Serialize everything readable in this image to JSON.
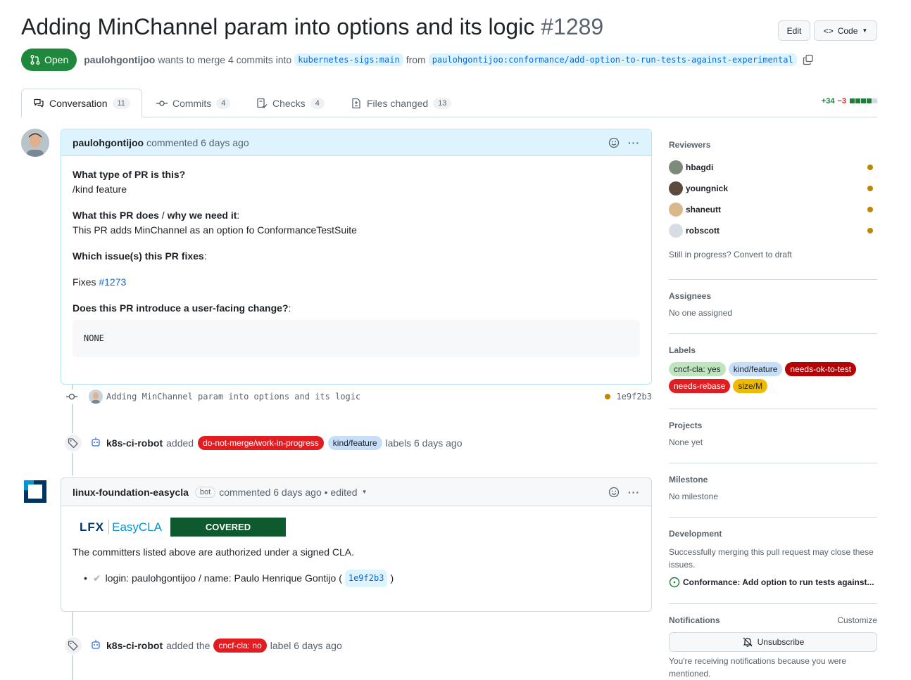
{
  "pr": {
    "title": "Adding MinChannel param into options and its logic",
    "number": "#1289",
    "state": "Open",
    "author": "paulohgontijoo",
    "merge_text": "wants to merge 4 commits into",
    "base_branch": "kubernetes-sigs:main",
    "from_text": "from",
    "head_branch": "paulohgontijoo:conformance/add-option-to-run-tests-against-experimental"
  },
  "header_buttons": {
    "edit": "Edit",
    "code": "Code"
  },
  "tabs": [
    {
      "label": "Conversation",
      "count": "11"
    },
    {
      "label": "Commits",
      "count": "4"
    },
    {
      "label": "Checks",
      "count": "4"
    },
    {
      "label": "Files changed",
      "count": "13"
    }
  ],
  "diffstat": {
    "additions": "+34",
    "deletions": "−3"
  },
  "comment1": {
    "author": "paulohgontijoo",
    "meta": "commented 6 days ago",
    "q1": "What type of PR is this?",
    "a1": "/kind feature",
    "q2_a": "What this PR does",
    "q2_sep": " / ",
    "q2_b": "why we need it",
    "q2_colon": ":",
    "a2": "This PR adds MinChannel as an option fo ConformanceTestSuite",
    "q3": "Which issue(s) this PR fixes",
    "q3_colon": ":",
    "fixes_text": "Fixes",
    "fixes_link": "#1273",
    "q4": "Does this PR introduce a user-facing change?",
    "q4_colon": ":",
    "code": "NONE"
  },
  "commit_event": {
    "message": "Adding MinChannel param into options and its logic",
    "sha": "1e9f2b3"
  },
  "label_event1": {
    "actor": "k8s-ci-robot",
    "verb": "added",
    "labels": [
      {
        "name": "do-not-merge/work-in-progress",
        "bg": "#e11d21",
        "fg": "#ffffff"
      },
      {
        "name": "kind/feature",
        "bg": "#c7def8",
        "fg": "#1f2328"
      }
    ],
    "suffix": "labels 6 days ago"
  },
  "comment2": {
    "author": "linux-foundation-easycla",
    "badge": "bot",
    "meta": "commented 6 days ago • edited",
    "logo_lfx": "LFX",
    "logo_easycla": "EasyCLA",
    "covered": "COVERED",
    "text": "The committers listed above are authorized under a signed CLA.",
    "item": "login: paulohgontijoo / name: Paulo Henrique Gontijo (",
    "item_sha": "1e9f2b3",
    "item_close": ")"
  },
  "label_event2": {
    "actor": "k8s-ci-robot",
    "verb": "added the",
    "label": {
      "name": "cncf-cla: no",
      "bg": "#e11d21",
      "fg": "#ffffff"
    },
    "suffix": "label 6 days ago"
  },
  "sidebar": {
    "reviewers_title": "Reviewers",
    "reviewers": [
      "hbagdi",
      "youngnick",
      "shaneutt",
      "robscott"
    ],
    "draft_text": "Still in progress? Convert to draft",
    "assignees_title": "Assignees",
    "assignees_value": "No one assigned",
    "labels_title": "Labels",
    "labels": [
      {
        "name": "cncf-cla: yes",
        "bg": "#bfe5bf",
        "fg": "#1f2328"
      },
      {
        "name": "kind/feature",
        "bg": "#c7def8",
        "fg": "#1f2328"
      },
      {
        "name": "needs-ok-to-test",
        "bg": "#b60205",
        "fg": "#ffffff"
      },
      {
        "name": "needs-rebase",
        "bg": "#e11d21",
        "fg": "#ffffff"
      },
      {
        "name": "size/M",
        "bg": "#eebb00",
        "fg": "#1f2328"
      }
    ],
    "projects_title": "Projects",
    "projects_value": "None yet",
    "milestone_title": "Milestone",
    "milestone_value": "No milestone",
    "development_title": "Development",
    "development_text": "Successfully merging this pull request may close these issues.",
    "development_issue": "Conformance: Add option to run tests against...",
    "notifications_title": "Notifications",
    "customize": "Customize",
    "unsubscribe": "Unsubscribe",
    "notif_reason": "You're receiving notifications because you were mentioned."
  },
  "colors": {
    "open": "#1f883d",
    "accent": "#0969da",
    "pending": "#bf8700"
  }
}
